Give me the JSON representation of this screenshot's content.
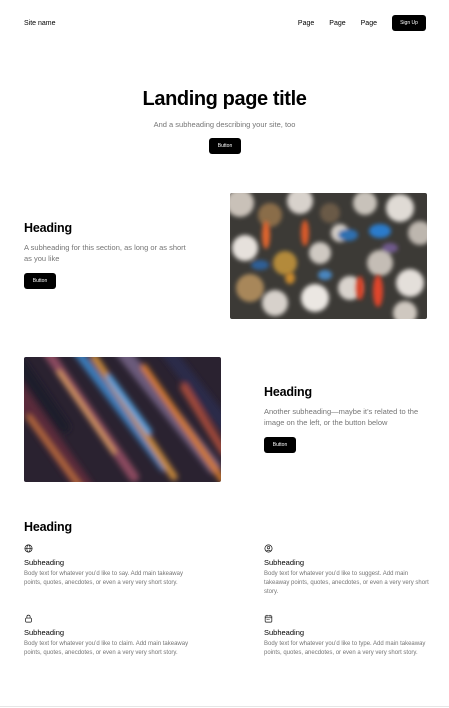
{
  "nav": {
    "site_name": "Site name",
    "links": [
      "Page",
      "Page",
      "Page"
    ],
    "cta_label": "Sign Up"
  },
  "hero": {
    "title": "Landing page title",
    "subtitle": "And a subheading describing your site, too",
    "button_label": "Button"
  },
  "section1": {
    "heading": "Heading",
    "subheading": "A subheading for this section, as long or as short as you like",
    "button_label": "Button",
    "image_desc": "blurred-autumn-forest-photo"
  },
  "section2": {
    "heading": "Heading",
    "subheading": "Another subheading—maybe it’s related to the image on the left, or the button below",
    "button_label": "Button",
    "image_desc": "abstract-light-streaks-photo"
  },
  "features": {
    "heading": "Heading",
    "items": [
      {
        "icon": "globe-icon",
        "title": "Subheading",
        "body": "Body text for whatever you’d like to say. Add main takeaway points, quotes, anecdotes, or even a very very short story."
      },
      {
        "icon": "user-circle-icon",
        "title": "Subheading",
        "body": "Body text for whatever you’d like to suggest. Add main takeaway points, quotes, anecdotes, or even a very very short story."
      },
      {
        "icon": "lock-icon",
        "title": "Subheading",
        "body": "Body text for whatever you’d like to claim. Add main takeaway points, quotes, anecdotes, or even a very very short story."
      },
      {
        "icon": "calendar-icon",
        "title": "Subheading",
        "body": "Body text for whatever you’d like to type. Add main takeaway points, quotes, anecdotes, or even a very very short story."
      }
    ]
  }
}
